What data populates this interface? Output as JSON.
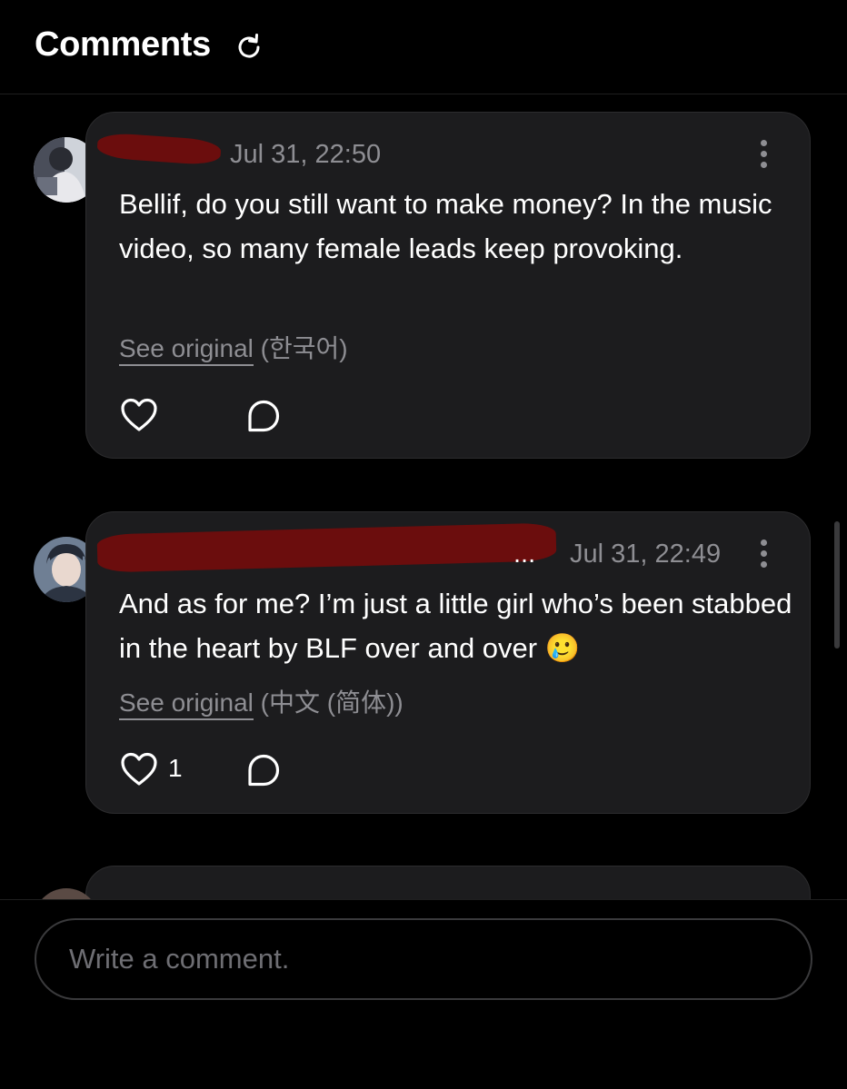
{
  "header": {
    "title": "Comments",
    "refresh_icon": "refresh-icon"
  },
  "comments": [
    {
      "timestamp": "Jul 31, 22:50",
      "text": "Bellif, do you still want to make money? In the music video, so many female leads keep provoking.",
      "see_original_label": "See original",
      "original_language": "(한국어)",
      "likes": ""
    },
    {
      "timestamp": "Jul 31, 22:49",
      "name_tail": "...",
      "text": "And as for me? I’m just a little girl who’s been stabbed in the heart by BLF over and over 🥲",
      "see_original_label": "See original",
      "original_language": "(中文 (简体))",
      "likes": "1"
    }
  ],
  "footer": {
    "input_placeholder": "Write a comment."
  },
  "colors": {
    "background": "#000000",
    "card": "#1c1c1e",
    "muted_text": "#8e8e93",
    "redaction": "#6b0d0d"
  }
}
